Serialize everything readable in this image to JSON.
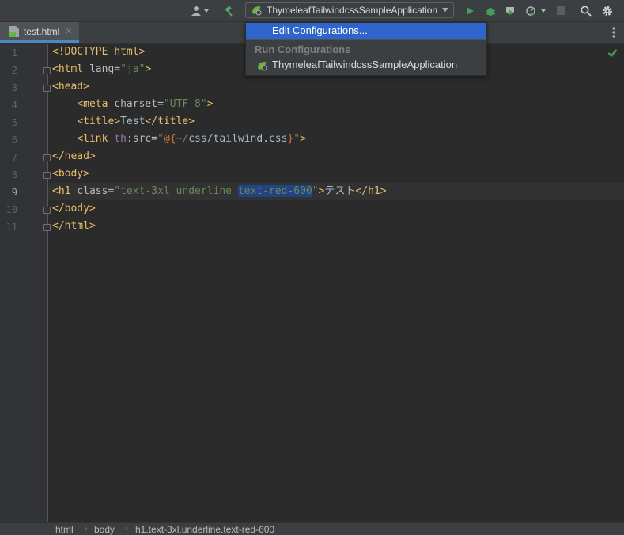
{
  "toolbar": {
    "run_config_label": "ThymeleafTailwindcssSampleApplication",
    "icons": [
      "user-icon",
      "hammer-icon",
      "spring-boot-icon",
      "run-icon",
      "debug-icon",
      "coverage-icon",
      "profile-icon",
      "stop-icon",
      "search-icon",
      "gear-icon"
    ]
  },
  "tabs": [
    {
      "label": "test.html",
      "close": "✕"
    }
  ],
  "editor": {
    "line_numbers": [
      "1",
      "2",
      "3",
      "4",
      "5",
      "6",
      "7",
      "8",
      "9",
      "10",
      "11"
    ],
    "current_line": 9,
    "colors": {
      "tag": "#e8bf6a",
      "attribute": "#bababa",
      "value": "#6a8759",
      "namespace": "#9876aa",
      "expression": "#cc7832",
      "selection": "#214283"
    },
    "lines": [
      [
        {
          "t": "<!DOCTYPE html>",
          "c": "tag"
        }
      ],
      [
        {
          "t": "<html ",
          "c": "tag"
        },
        {
          "t": "lang=",
          "c": "attr"
        },
        {
          "t": "\"ja\"",
          "c": "val"
        },
        {
          "t": ">",
          "c": "tag"
        }
      ],
      [
        {
          "t": "<head>",
          "c": "tag"
        }
      ],
      [
        {
          "t": "    ",
          "c": "text"
        },
        {
          "t": "<meta ",
          "c": "tag"
        },
        {
          "t": "charset=",
          "c": "attr"
        },
        {
          "t": "\"UTF-8\"",
          "c": "val"
        },
        {
          "t": ">",
          "c": "tag"
        }
      ],
      [
        {
          "t": "    ",
          "c": "text"
        },
        {
          "t": "<title>",
          "c": "tag"
        },
        {
          "t": "Test",
          "c": "text"
        },
        {
          "t": "</title>",
          "c": "tag"
        }
      ],
      [
        {
          "t": "    ",
          "c": "text"
        },
        {
          "t": "<link ",
          "c": "tag"
        },
        {
          "t": "th",
          "c": "ns"
        },
        {
          "t": ":src=",
          "c": "attr"
        },
        {
          "t": "\"",
          "c": "val"
        },
        {
          "t": "@{",
          "c": "expr"
        },
        {
          "t": "~/",
          "c": "val"
        },
        {
          "t": "css/",
          "c": "text"
        },
        {
          "t": "tailwind.css",
          "c": "text"
        },
        {
          "t": "}",
          "c": "expr"
        },
        {
          "t": "\"",
          "c": "val"
        },
        {
          "t": ">",
          "c": "tag"
        }
      ],
      [
        {
          "t": "</head>",
          "c": "tag"
        }
      ],
      [
        {
          "t": "<body>",
          "c": "tag"
        }
      ],
      [
        {
          "t": "<h1 ",
          "c": "tag"
        },
        {
          "t": "class=",
          "c": "attr"
        },
        {
          "t": "\"text-3xl underline ",
          "c": "val"
        },
        {
          "t": "text-red-600",
          "c": "val-hl"
        },
        {
          "t": "\"",
          "c": "val"
        },
        {
          "t": ">",
          "c": "tag"
        },
        {
          "t": "テスト",
          "c": "text"
        },
        {
          "t": "</h1>",
          "c": "tag"
        }
      ],
      [
        {
          "t": "</body>",
          "c": "tag"
        }
      ],
      [
        {
          "t": "</html>",
          "c": "tag"
        }
      ]
    ]
  },
  "popup": {
    "edit_label": "Edit Configurations...",
    "section_heading": "Run Configurations",
    "run_item_label": "ThymeleafTailwindcssSampleApplication"
  },
  "breadcrumbs": [
    "html",
    "body",
    "h1.text-3xl.underline.text-red-600"
  ]
}
